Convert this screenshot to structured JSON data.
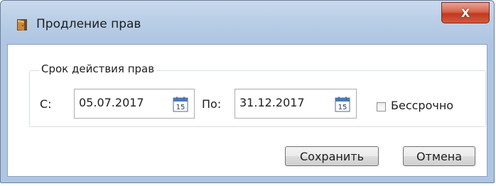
{
  "window": {
    "title": "Продление прав",
    "close_label": "X"
  },
  "group": {
    "label": "Срок действия прав"
  },
  "from": {
    "label": "С:",
    "value": "05.07.2017",
    "calendar_day": "15"
  },
  "to": {
    "label": "По:",
    "value": "31.12.2017",
    "calendar_day": "15"
  },
  "unlimited": {
    "label": "Бессрочно",
    "checked": false
  },
  "buttons": {
    "save": "Сохранить",
    "cancel": "Отмена"
  },
  "colors": {
    "accent": "#2b6cb3",
    "close": "#c2381f"
  },
  "icons": {
    "app": "door-icon",
    "calendar": "calendar-icon",
    "close": "close-icon"
  }
}
